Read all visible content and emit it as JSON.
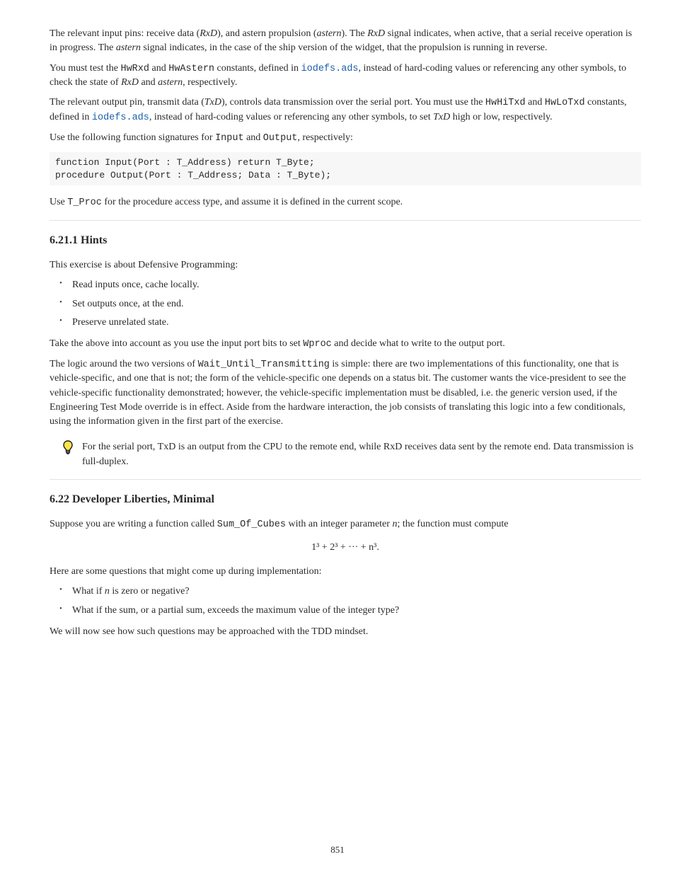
{
  "p1": {
    "t1": "The relevant input pins: receive data (",
    "t2": "RxD",
    "t3": "), and astern propulsion (",
    "t4": "astern",
    "t5": "). The ",
    "t6": "RxD",
    "t7": " signal indicates, when active, that a serial receive operation is in progress. The ",
    "t8": "astern",
    "t9": " signal indicates, in the case of the ship version of the widget, that the propulsion is running in reverse."
  },
  "p2": {
    "t1": "You must test the ",
    "t2": "HwRxd",
    "t3": " and ",
    "t4": "HwAstern",
    "t5": " constants, defined in ",
    "t6": "iodefs.ads",
    "t7": ", instead of hard-coding values or referencing any other symbols, to check the state of ",
    "t8": "RxD",
    "t9": " and ",
    "t10": "astern",
    "t11": ", respectively."
  },
  "p3": {
    "t1": "The relevant output pin, transmit data (",
    "t2": "TxD",
    "t3": "), controls data transmission over the serial port. You must use the ",
    "t4": "HwHiTxd",
    "t5": " and ",
    "t6": "HwLoTxd",
    "t7": " constants, defined in ",
    "t8": "iodefs.ads",
    "t9": ", instead of hard-coding values or referencing any other symbols, to set ",
    "t10": "TxD",
    "t11": " high or low, respectively."
  },
  "p4": {
    "t1": "Use the following function signatures for ",
    "t2": "Input",
    "t3": " and ",
    "t4": "Output",
    "t5": ", respectively:"
  },
  "code1": "function Input(Port : T_Address) return T_Byte;\nprocedure Output(Port : T_Address; Data : T_Byte);",
  "p5": {
    "t1": "Use ",
    "t2": "T_Proc",
    "t3": " for the procedure access type, and assume it is defined in the current scope."
  },
  "s1": {
    "title": "6.21.1 Hints",
    "p1": "This exercise is about Defensive Programming:",
    "b1": "Read inputs once, cache locally.",
    "b2": "Set outputs once, at the end.",
    "b3": "Preserve unrelated state.",
    "p2a": "Take the above into account as you use the input port bits to set ",
    "p2b": "Wproc",
    "p2c": " and decide what to write to the output port.",
    "p3a": "The logic around the two versions of ",
    "p3b": "Wait_Until_Transmitting",
    "p3c": " is simple: there are two implementations of this functionality, one that is vehicle-specific, and one that is not; the form of the vehicle-specific one depends on a status bit. The customer wants the vice-president to see the vehicle-specific functionality demonstrated; however, the vehicle-specific implementation must be disabled, i.e. the generic version used, if the Engineering Test Mode override is in effect. Aside from the hardware interaction, the job consists of translating this logic into a few conditionals, using the information given in the first part of the exercise.",
    "tip": "For the serial port, TxD is an output from the CPU to the remote end, while RxD receives data sent by the remote end. Data transmission is full-duplex."
  },
  "s2": {
    "title": "6.22     Developer Liberties, Minimal",
    "p1a": "Suppose you are writing a function called ",
    "p1b": "Sum_Of_Cubes",
    "p1c": " with an integer parameter ",
    "p1d": "n",
    "p1e": "; the function must compute",
    "formula": "1³ + 2³ + ··· + n³.",
    "p2": "Here are some questions that might come up during implementation:",
    "b1a": "What if ",
    "b1b": "n",
    "b1c": " is zero or negative?",
    "b2": "What if the sum, or a partial sum, exceeds the maximum value of the integer type?",
    "p3": "We will now see how such questions may be approached with the TDD mindset."
  },
  "pagenum": "851"
}
